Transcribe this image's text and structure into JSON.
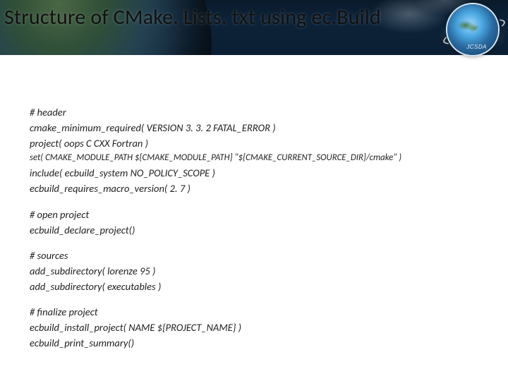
{
  "title": "Structure of CMake. Lists. txt using ec.Build",
  "logo_text": "JCSDA",
  "blocks": {
    "header_comment": "# header",
    "l1": "cmake_minimum_required( VERSION 3. 3. 2 FATAL_ERROR )",
    "l2": "project( oops C CXX Fortran )",
    "l3": "set( CMAKE_MODULE_PATH ${CMAKE_MODULE_PATH} \"${CMAKE_CURRENT_SOURCE_DIR}/cmake\" )",
    "l4": "include( ecbuild_system NO_POLICY_SCOPE )",
    "l5": "ecbuild_requires_macro_version( 2. 7 )",
    "open_comment": "# open project",
    "l6": "ecbuild_declare_project()",
    "src_comment": "# sources",
    "l7": "add_subdirectory( lorenze 95 )",
    "l8": "add_subdirectory( executables )",
    "final_comment": "# finalize project",
    "l9": "ecbuild_install_project( NAME ${PROJECT_NAME} )",
    "l10": "ecbuild_print_summary()"
  }
}
